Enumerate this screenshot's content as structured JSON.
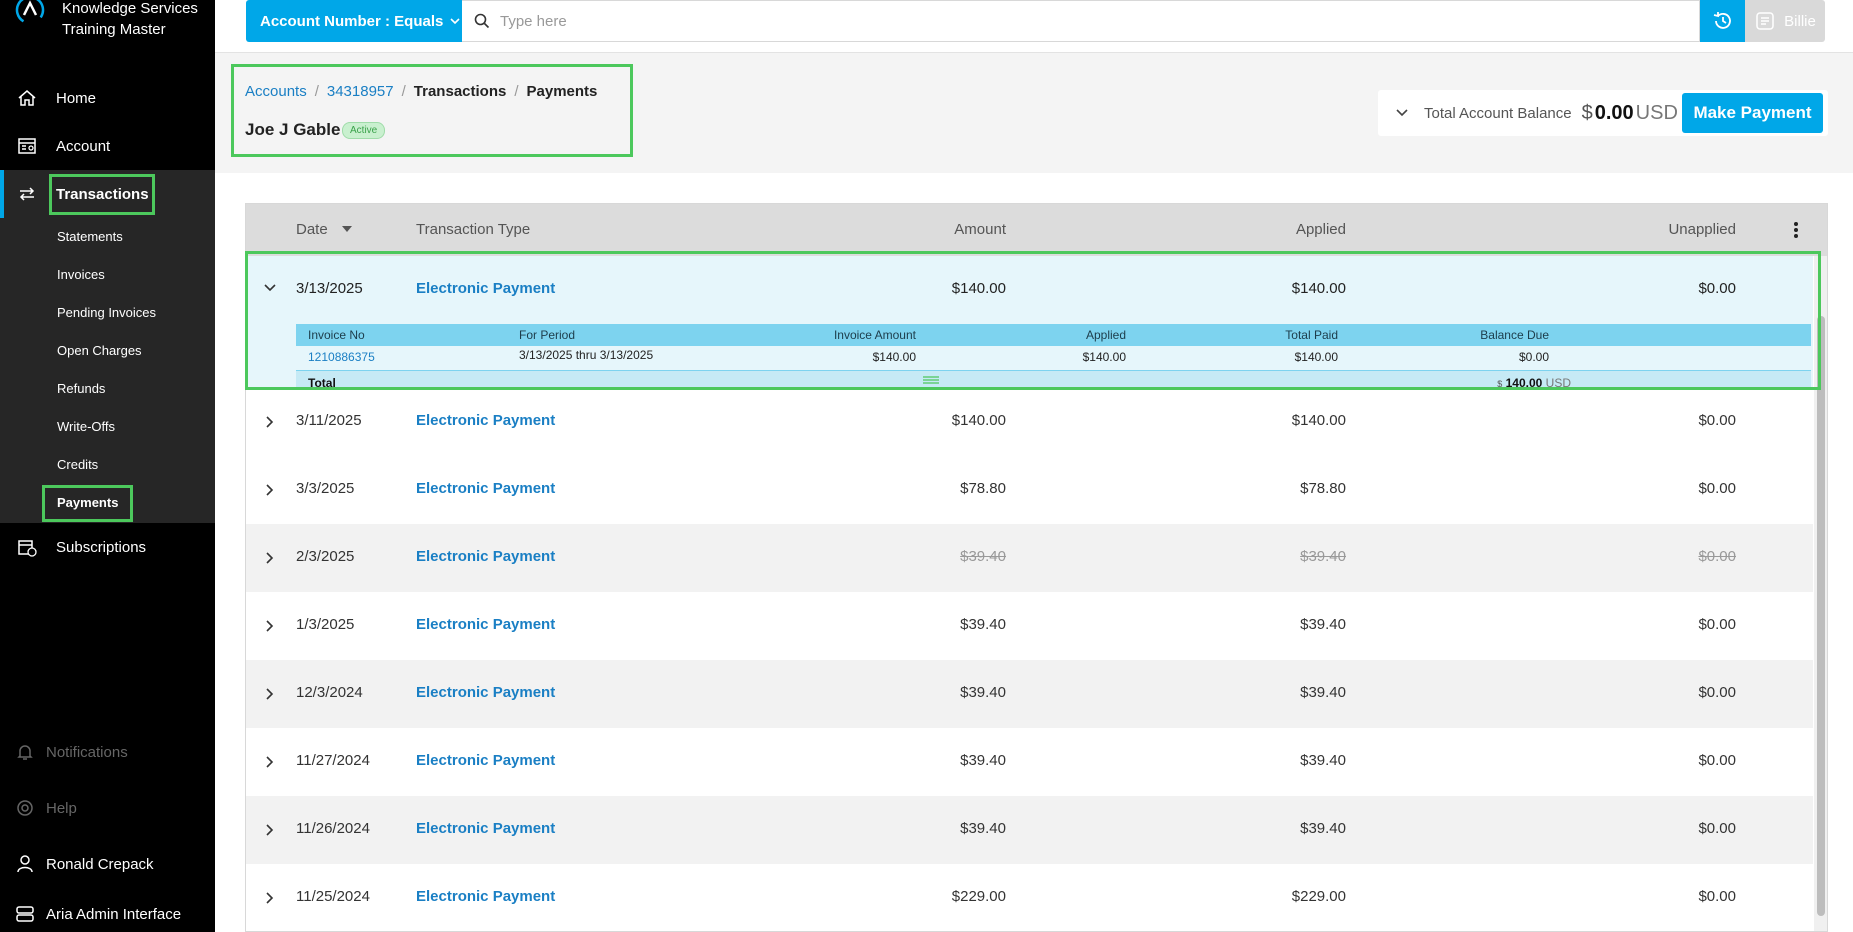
{
  "brand": {
    "line1": "Knowledge Services",
    "line2": "Training Master"
  },
  "sidebar": {
    "items": [
      {
        "label": "Home",
        "icon": "home-icon"
      },
      {
        "label": "Account",
        "icon": "account-icon"
      },
      {
        "label": "Transactions",
        "icon": "transactions-icon"
      },
      {
        "label": "Subscriptions",
        "icon": "subscriptions-icon"
      }
    ],
    "submenu": [
      "Statements",
      "Invoices",
      "Pending Invoices",
      "Open Charges",
      "Refunds",
      "Write-Offs",
      "Credits",
      "Payments"
    ],
    "bottom": [
      {
        "label": "Notifications",
        "icon": "bell-icon"
      },
      {
        "label": "Help",
        "icon": "help-icon"
      },
      {
        "label": "Ronald Crepack",
        "icon": "user-icon"
      },
      {
        "label": "Aria Admin Interface",
        "icon": "admin-icon"
      }
    ]
  },
  "search": {
    "filter_label": "Account Number : Equals",
    "placeholder": "Type here",
    "billie_label": "Billie"
  },
  "breadcrumb": {
    "accounts": "Accounts",
    "account_no": "34318957",
    "transactions": "Transactions",
    "payments": "Payments",
    "sep": "/"
  },
  "customer": {
    "name": "Joe J Gable",
    "status": "Active"
  },
  "balance": {
    "label": "Total Account Balance",
    "currency_symbol": "$",
    "value": "0.00",
    "unit": "USD",
    "button": "Make Payment"
  },
  "table": {
    "headers": {
      "date": "Date",
      "type": "Transaction Type",
      "amount": "Amount",
      "applied": "Applied",
      "unapplied": "Unapplied"
    },
    "expanded": {
      "date": "3/13/2025",
      "type": "Electronic Payment",
      "amount": "$140.00",
      "applied": "$140.00",
      "unapplied": "$0.00",
      "sub_headers": {
        "invoice_no": "Invoice No",
        "period": "For Period",
        "invoice_amount": "Invoice Amount",
        "applied": "Applied",
        "total_paid": "Total Paid",
        "balance_due": "Balance Due"
      },
      "sub_row": {
        "invoice_no": "1210886375",
        "period": "3/13/2025 thru 3/13/2025",
        "invoice_amount": "$140.00",
        "applied": "$140.00",
        "total_paid": "$140.00",
        "balance_due": "$0.00"
      },
      "total": {
        "label": "Total",
        "currency_symbol": "$",
        "value": "140.00",
        "unit": "USD"
      }
    },
    "rows": [
      {
        "date": "3/11/2025",
        "type": "Electronic Payment",
        "amount": "$140.00",
        "applied": "$140.00",
        "unapplied": "$0.00"
      },
      {
        "date": "3/3/2025",
        "type": "Electronic Payment",
        "amount": "$78.80",
        "applied": "$78.80",
        "unapplied": "$0.00"
      },
      {
        "date": "2/3/2025",
        "type": "Electronic Payment",
        "amount": "$39.40",
        "applied": "$39.40",
        "unapplied": "$0.00"
      },
      {
        "date": "1/3/2025",
        "type": "Electronic Payment",
        "amount": "$39.40",
        "applied": "$39.40",
        "unapplied": "$0.00"
      },
      {
        "date": "12/3/2024",
        "type": "Electronic Payment",
        "amount": "$39.40",
        "applied": "$39.40",
        "unapplied": "$0.00"
      },
      {
        "date": "11/27/2024",
        "type": "Electronic Payment",
        "amount": "$39.40",
        "applied": "$39.40",
        "unapplied": "$0.00"
      },
      {
        "date": "11/26/2024",
        "type": "Electronic Payment",
        "amount": "$39.40",
        "applied": "$39.40",
        "unapplied": "$0.00"
      },
      {
        "date": "11/25/2024",
        "type": "Electronic Payment",
        "amount": "$229.00",
        "applied": "$229.00",
        "unapplied": "$0.00"
      }
    ]
  },
  "colors": {
    "accent": "#00a7e8",
    "link": "#1a7fc4",
    "highlight": "#4cc85c",
    "sidebar": "#000000"
  }
}
